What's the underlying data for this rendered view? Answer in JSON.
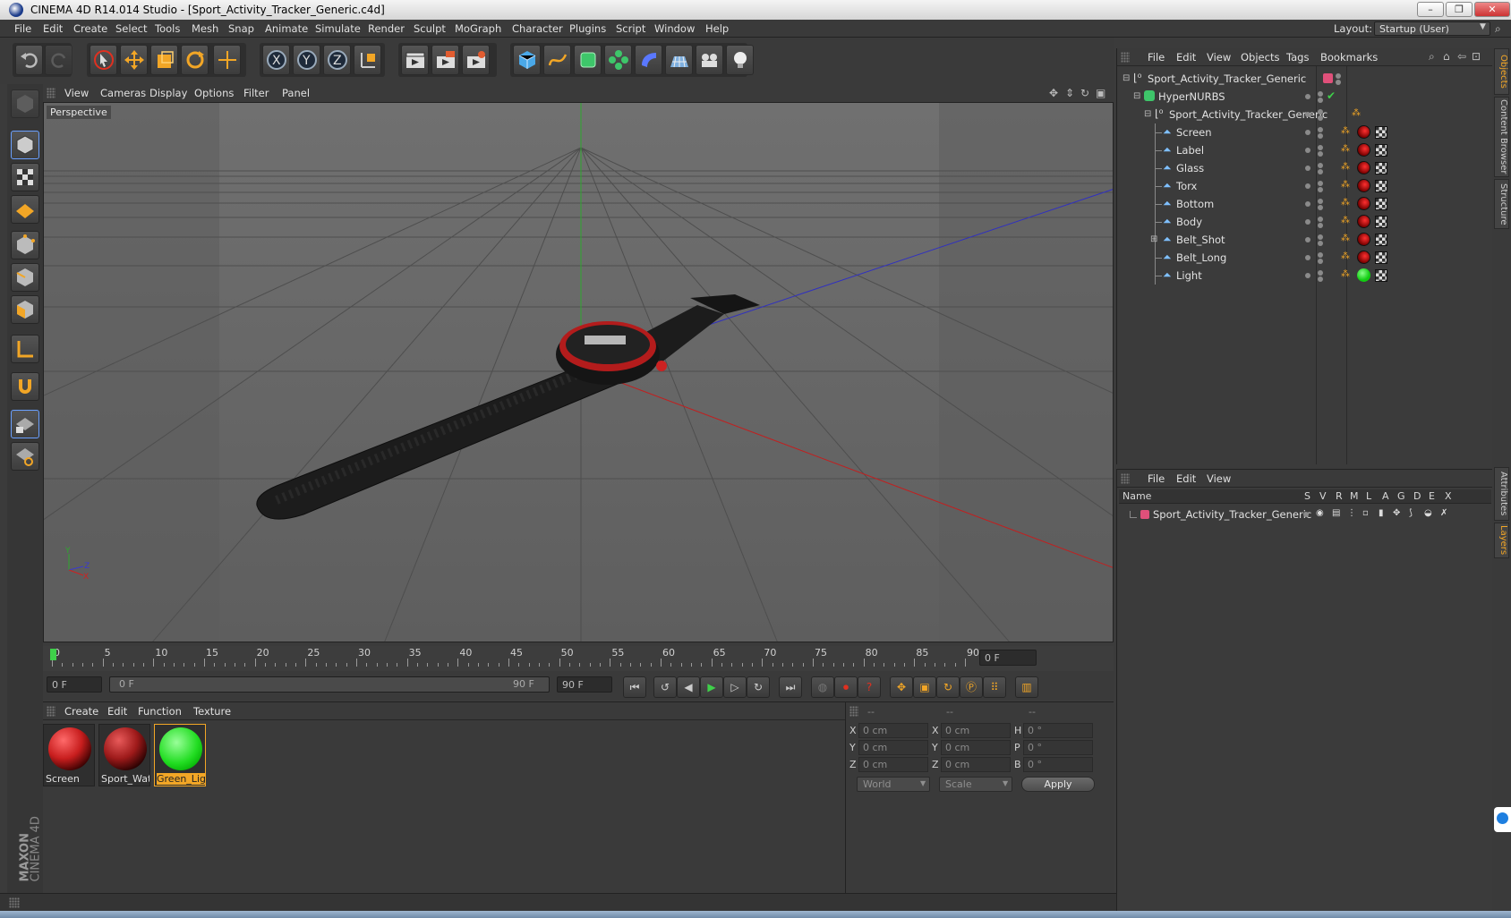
{
  "window": {
    "title": "CINEMA 4D R14.014 Studio - [Sport_Activity_Tracker_Generic.c4d]",
    "minimize": "–",
    "restore": "❐",
    "close": "✕"
  },
  "menu": [
    "File",
    "Edit",
    "Create",
    "Select",
    "Tools",
    "Mesh",
    "Snap",
    "Animate",
    "Simulate",
    "Render",
    "Sculpt",
    "MoGraph",
    "Character",
    "Plugins",
    "Script",
    "Window",
    "Help"
  ],
  "layout": {
    "label": "Layout:",
    "value": "Startup (User)"
  },
  "viewport": {
    "menu": [
      "View",
      "Cameras",
      "Display",
      "Options",
      "Filter",
      "Panel"
    ],
    "label": "Perspective",
    "axes": {
      "y": "Y",
      "x": "X",
      "z": "Z"
    }
  },
  "timeline": {
    "ticks": [
      "0",
      "5",
      "10",
      "15",
      "20",
      "25",
      "30",
      "35",
      "40",
      "45",
      "50",
      "55",
      "60",
      "65",
      "70",
      "75",
      "80",
      "85",
      "90"
    ],
    "current_frame": "0 F",
    "start_field": "0 F",
    "range_start": "0 F",
    "range_end": "90 F",
    "end_field": "90 F"
  },
  "materials": {
    "menu": [
      "Create",
      "Edit",
      "Function",
      "Texture"
    ],
    "items": [
      {
        "name": "Screen",
        "color": "#c81e1e"
      },
      {
        "name": "Sport_Wat",
        "color": "#9e1a1a"
      },
      {
        "name": "Green_Ligh",
        "color": "#22dd22"
      }
    ]
  },
  "coordinates": {
    "headers": [
      "--",
      "--",
      "--"
    ],
    "rows": [
      {
        "l1": "X",
        "v1": "0 cm",
        "l2": "X",
        "v2": "0 cm",
        "l3": "H",
        "v3": "0 °"
      },
      {
        "l1": "Y",
        "v1": "0 cm",
        "l2": "Y",
        "v2": "0 cm",
        "l3": "P",
        "v3": "0 °"
      },
      {
        "l1": "Z",
        "v1": "0 cm",
        "l2": "Z",
        "v2": "0 cm",
        "l3": "B",
        "v3": "0 °"
      }
    ],
    "space": "World",
    "mode": "Scale",
    "apply": "Apply"
  },
  "object_manager": {
    "menu": [
      "File",
      "Edit",
      "View",
      "Objects",
      "Tags",
      "Bookmarks"
    ],
    "objects": [
      {
        "name": "Sport_Activity_Tracker_Generic"
      },
      {
        "name": "HyperNURBS"
      },
      {
        "name": "Sport_Activity_Tracker_Generic"
      },
      {
        "name": "Screen"
      },
      {
        "name": "Label"
      },
      {
        "name": "Glass"
      },
      {
        "name": "Torx"
      },
      {
        "name": "Bottom"
      },
      {
        "name": "Body"
      },
      {
        "name": "Belt_Shot"
      },
      {
        "name": "Belt_Long"
      },
      {
        "name": "Light"
      }
    ]
  },
  "layer_manager": {
    "menu": [
      "File",
      "Edit",
      "View"
    ],
    "columns": [
      "Name",
      "S",
      "V",
      "R",
      "M",
      "L",
      "A",
      "G",
      "D",
      "E",
      "X"
    ],
    "layers": [
      {
        "name": "Sport_Activity_Tracker_Generic",
        "color": "#e0507a"
      }
    ]
  },
  "right_tabs": [
    "Objects",
    "Content Browser",
    "Structure",
    "Attributes",
    "Layers"
  ],
  "brand": {
    "line1": "MAXON",
    "line2": "CINEMA 4D"
  }
}
